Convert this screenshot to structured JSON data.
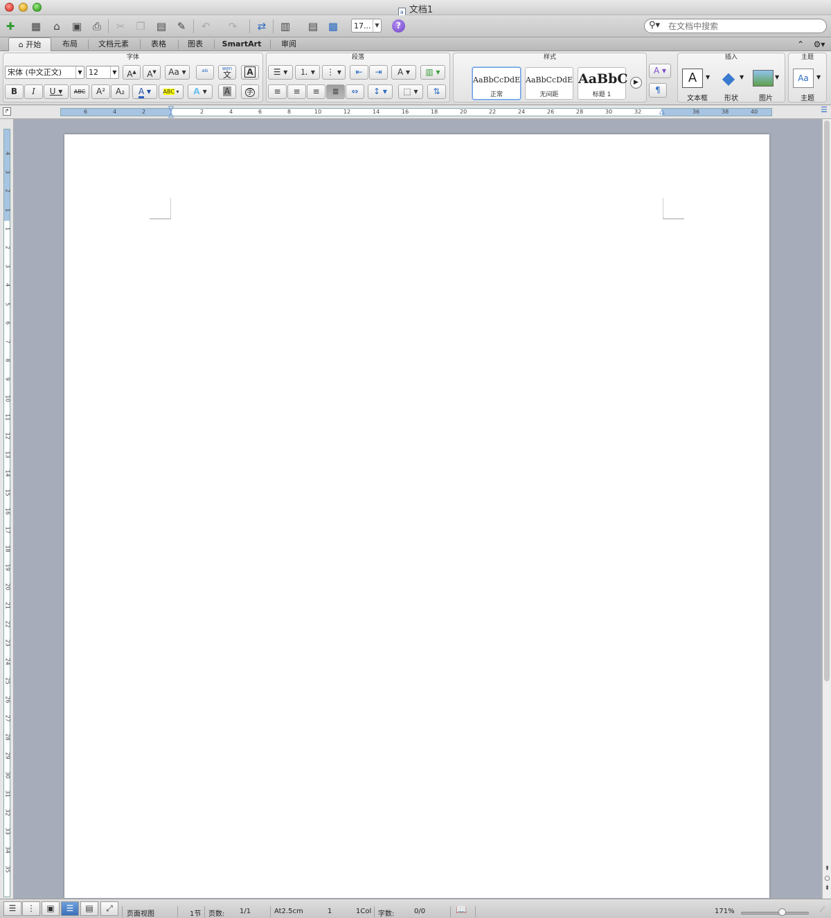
{
  "window": {
    "title": "文档1"
  },
  "toolbar": {
    "zoom_value": "17...",
    "help_label": "?"
  },
  "search": {
    "placeholder": "在文档中搜索"
  },
  "tabs": [
    {
      "label": "开始"
    },
    {
      "label": "布局"
    },
    {
      "label": "文档元素"
    },
    {
      "label": "表格"
    },
    {
      "label": "图表"
    },
    {
      "label": "SmartArt"
    },
    {
      "label": "审阅"
    }
  ],
  "ribbon": {
    "font_group": {
      "title": "字体",
      "font_name": "宋体 (中文正文)",
      "font_size": "12",
      "bold": "B",
      "italic": "I",
      "underline": "U",
      "strike": "ABC",
      "superscript": "A²",
      "subscript": "A₂",
      "phonetic": "wen",
      "phonetic_char": "文",
      "char_border": "A",
      "enclose_char": "字",
      "font_color": "A",
      "highlight": "ABC",
      "text_effects": "A",
      "shading": "A",
      "grow": "A",
      "shrink": "A",
      "change_case": "Aa"
    },
    "paragraph_group": {
      "title": "段落"
    },
    "styles_group": {
      "title": "样式",
      "styles": [
        {
          "sample": "AaBbCcDdEe",
          "name": "正常"
        },
        {
          "sample": "AaBbCcDdEe",
          "name": "无间距"
        },
        {
          "sample": "AaBbC",
          "name": "标题 1"
        }
      ]
    },
    "insert_group": {
      "title": "插入",
      "textbox": "文本框",
      "shapes": "形状",
      "picture": "图片"
    },
    "theme_group": {
      "title": "主题",
      "themes": "主题",
      "theme_sample": "Aa"
    }
  },
  "ruler": {
    "h_labels": [
      "6",
      "4",
      "2",
      "2",
      "4",
      "6",
      "8",
      "10",
      "12",
      "14",
      "16",
      "18",
      "20",
      "22",
      "24",
      "26",
      "28",
      "30",
      "32",
      "36",
      "38",
      "40"
    ],
    "v_labels": [
      "4",
      "3",
      "2",
      "1",
      "1",
      "2",
      "3",
      "4",
      "5",
      "6",
      "7",
      "8",
      "9",
      "10",
      "11",
      "12",
      "13",
      "14",
      "15",
      "16",
      "17",
      "18",
      "19",
      "20",
      "21",
      "22",
      "23",
      "24",
      "25",
      "26",
      "27",
      "28",
      "29",
      "30",
      "31",
      "32",
      "33",
      "34",
      "35"
    ]
  },
  "status": {
    "view": "页面视图",
    "section": "1节",
    "pages_label": "页数:",
    "pages_value": "1/1",
    "at": "At2.5cm",
    "line": "1",
    "col": "1Col",
    "words_label": "字数:",
    "words_value": "0/0",
    "zoom": "171%"
  },
  "colors": {
    "accent": "#3b6fb9",
    "canvas": "#a6acb9",
    "margin": "#a8c4e3"
  }
}
